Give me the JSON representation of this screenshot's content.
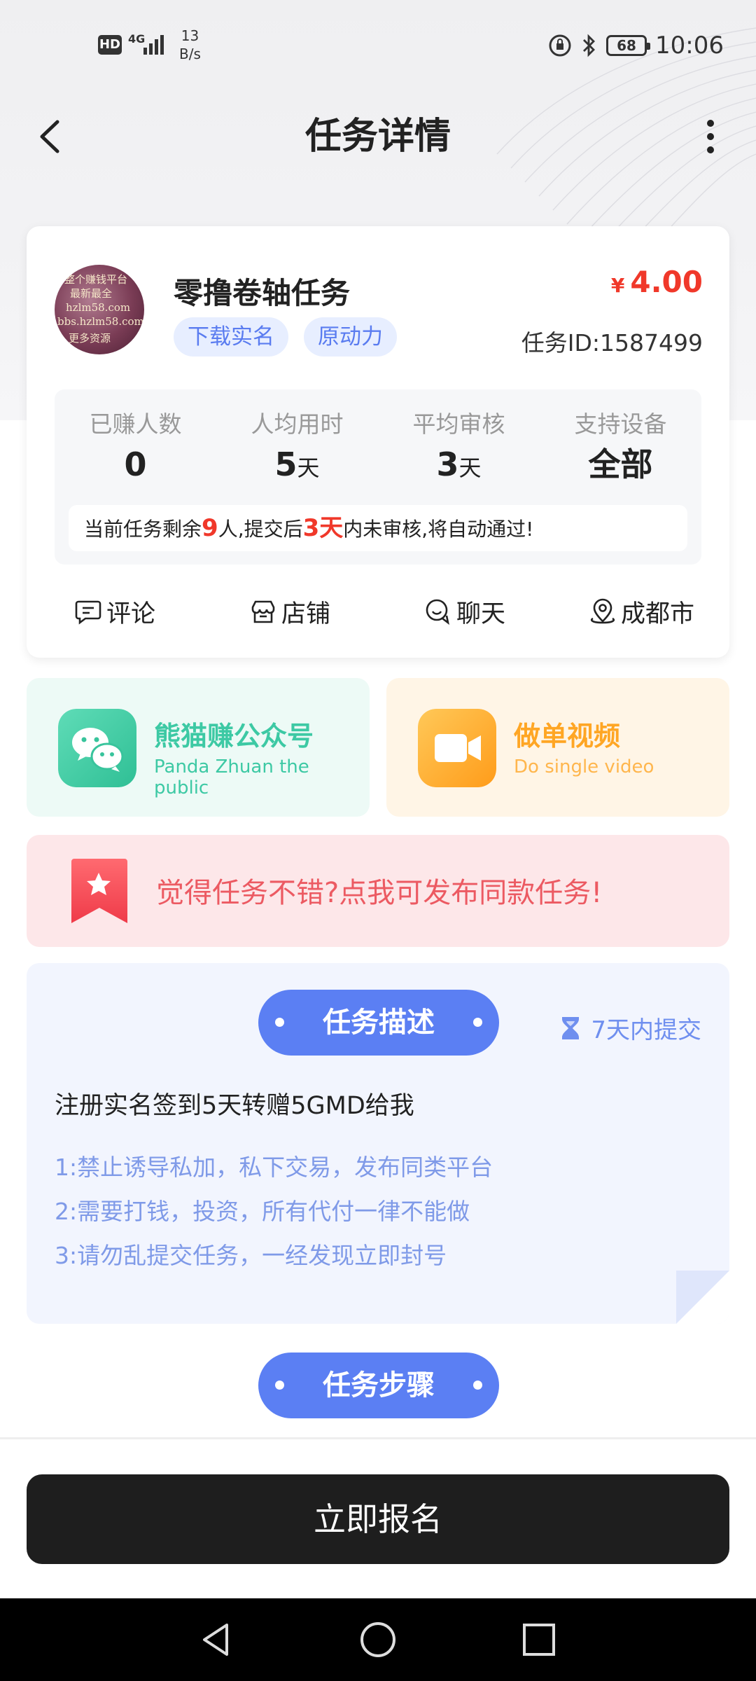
{
  "status_bar": {
    "hd": "HD",
    "network": "4G",
    "speed_value": "13",
    "speed_unit": "B/s",
    "battery": "68",
    "time": "10:06"
  },
  "header": {
    "title": "任务详情",
    "back_icon": "chevron-left-icon",
    "more_icon": "more-vertical-icon"
  },
  "task": {
    "avatar_text": [
      "整个赚钱平台",
      "最新最全",
      "hzlm58.com",
      "bbs.hzlm58.com",
      "更多资源"
    ],
    "name": "零撸卷轴任务",
    "tags": [
      "下载实名",
      "原动力"
    ],
    "currency": "¥",
    "price": "4.00",
    "task_id": "任务ID:1587499",
    "stats": [
      {
        "label": "已赚人数",
        "value": "0",
        "unit": ""
      },
      {
        "label": "人均用时",
        "value": "5",
        "unit": "天"
      },
      {
        "label": "平均审核",
        "value": "3",
        "unit": "天"
      },
      {
        "label": "支持设备",
        "value": "全部",
        "unit": ""
      }
    ],
    "notice": {
      "part1": "当前任务剩余",
      "remain": "9",
      "part2": "人,提交后",
      "days": "3天",
      "part3": "内未审核,将自动通过!"
    },
    "actions": [
      {
        "label": "评论",
        "icon": "comment-icon"
      },
      {
        "label": "店铺",
        "icon": "shop-icon"
      },
      {
        "label": "聊天",
        "icon": "chat-icon"
      },
      {
        "label": "成都市",
        "icon": "location-icon"
      }
    ]
  },
  "promo": {
    "left": {
      "title": "熊猫赚公众号",
      "subtitle": "Panda Zhuan the public",
      "icon": "wechat-icon",
      "color": "#3dc9a4"
    },
    "right": {
      "title": "做单视频",
      "subtitle": "Do single video",
      "icon": "video-camera-icon",
      "color": "#ffa624"
    }
  },
  "publish_banner": {
    "text": "觉得任务不错?点我可发布同款任务!",
    "icon": "bookmark-star-icon"
  },
  "description": {
    "title": "任务描述",
    "deadline": "7天内提交",
    "deadline_icon": "hourglass-icon",
    "main": "注册实名签到5天转赠5GMD给我",
    "rules": [
      "1:禁止诱导私加，私下交易，发布同类平台",
      "2:需要打钱，投资，所有代付一律不能做",
      "3:请勿乱提交任务，一经发现立即封号"
    ]
  },
  "steps": {
    "title": "任务步骤"
  },
  "footer": {
    "signup": "立即报名"
  },
  "colors": {
    "accent_blue": "#5b7ff3",
    "price_red": "#f0382a",
    "button_dark": "#1e1e1e"
  }
}
